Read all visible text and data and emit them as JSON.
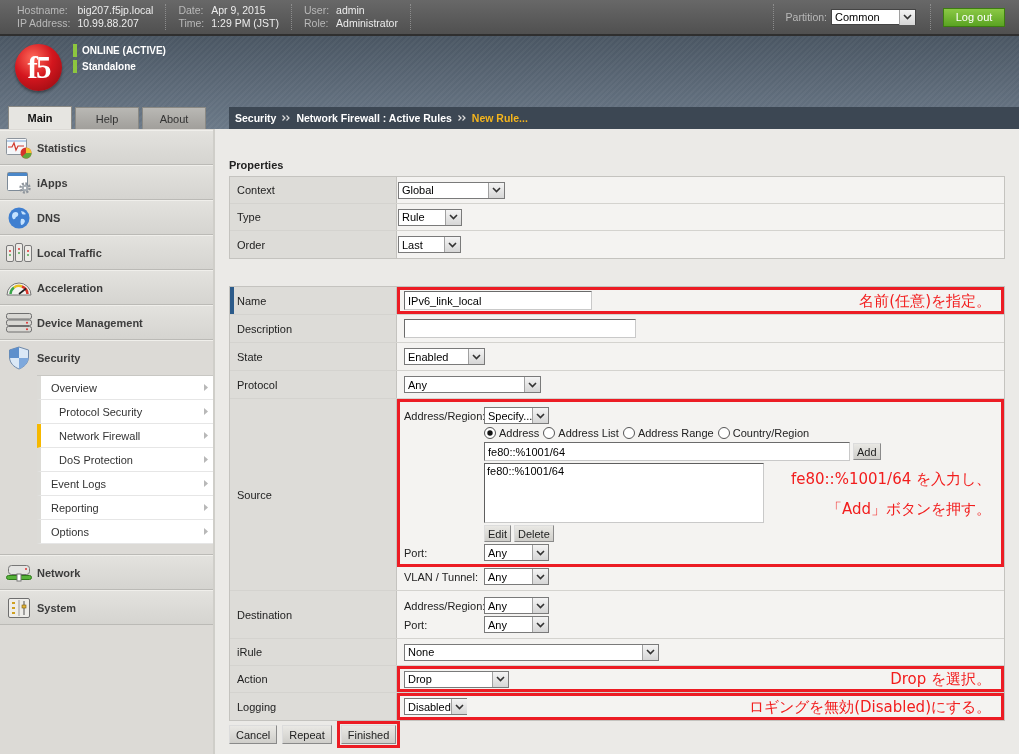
{
  "header": {
    "info_groups": [
      [
        {
          "label": "Hostname:",
          "value": "big207.f5jp.local"
        },
        {
          "label": "IP Address:",
          "value": "10.99.88.207"
        }
      ],
      [
        {
          "label": "Date:",
          "value": "Apr 9, 2015"
        },
        {
          "label": "Time:",
          "value": "1:29 PM (JST)"
        }
      ],
      [
        {
          "label": "User:",
          "value": "admin"
        },
        {
          "label": "Role:",
          "value": "Administrator"
        }
      ]
    ],
    "partition": {
      "label": "Partition:",
      "value": "Common"
    },
    "logout_button": "Log out"
  },
  "banner": {
    "logo_text": "f5",
    "status": [
      "ONLINE (ACTIVE)",
      "Standalone"
    ]
  },
  "tabs": [
    {
      "label": "Main",
      "selected": true
    },
    {
      "label": "Help",
      "selected": false
    },
    {
      "label": "About",
      "selected": false
    }
  ],
  "breadcrumb": [
    {
      "label": "Security",
      "current": false
    },
    {
      "label": "Network Firewall : Active Rules",
      "current": false
    },
    {
      "label": "New Rule...",
      "current": true
    }
  ],
  "sidebar": {
    "items": [
      {
        "label": "Statistics",
        "expanded": false
      },
      {
        "label": "iApps",
        "expanded": false
      },
      {
        "label": "DNS",
        "expanded": false
      },
      {
        "label": "Local Traffic",
        "expanded": false
      },
      {
        "label": "Acceleration",
        "expanded": false
      },
      {
        "label": "Device Management",
        "expanded": false
      },
      {
        "label": "Security",
        "expanded": true,
        "children": [
          {
            "label": "Overview",
            "selected": false,
            "children": [
              {
                "label": "Protocol Security",
                "selected": false
              },
              {
                "label": "Network Firewall",
                "selected": true
              },
              {
                "label": "DoS Protection",
                "selected": false
              }
            ]
          },
          {
            "label": "Event Logs",
            "selected": false
          },
          {
            "label": "Reporting",
            "selected": false
          },
          {
            "label": "Options",
            "selected": false
          }
        ]
      },
      {
        "label": "Network",
        "expanded": false
      },
      {
        "label": "System",
        "expanded": false
      }
    ]
  },
  "form": {
    "section_title": "Properties",
    "properties": [
      {
        "label": "Context",
        "value": "Global"
      },
      {
        "label": "Type",
        "value": "Rule"
      },
      {
        "label": "Order",
        "value": "Last"
      }
    ],
    "rule_rows": [
      {
        "label": "Name",
        "kind": "text",
        "required": true,
        "value": "IPv6_link_local",
        "annotation": [
          "名前(任意)を指定。"
        ]
      },
      {
        "label": "Description",
        "kind": "text",
        "required": false
      },
      {
        "label": "State",
        "kind": "select",
        "required": false,
        "value": "Enabled"
      },
      {
        "label": "Protocol",
        "kind": "select",
        "required": false,
        "value": "Any"
      },
      {
        "label": "Source",
        "kind": "source",
        "required": false,
        "address_region": {
          "label": "Address/Region:",
          "value": "Specify..."
        },
        "address_types": [
          {
            "label": "Address",
            "selected": true
          },
          {
            "label": "Address List",
            "selected": false
          },
          {
            "label": "Address Range",
            "selected": false
          },
          {
            "label": "Country/Region",
            "selected": false
          }
        ],
        "address_input": "fe80::%1001/64",
        "add_button": "Add",
        "address_list": [
          "fe80::%1001/64"
        ],
        "list_buttons": [
          "Edit",
          "Delete"
        ],
        "port": {
          "label": "Port:",
          "value": "Any"
        },
        "vlan": {
          "label": "VLAN / Tunnel:",
          "value": "Any"
        },
        "annotation": [
          "fe80::%1001/64 を入力し、",
          "「Add」ボタンを押す。"
        ]
      },
      {
        "label": "Destination",
        "kind": "destination",
        "required": false,
        "fields": [
          {
            "label": "Address/Region:",
            "value": "Any"
          },
          {
            "label": "Port:",
            "value": "Any"
          }
        ]
      },
      {
        "label": "iRule",
        "kind": "select",
        "required": false,
        "value": "None"
      },
      {
        "label": "Action",
        "kind": "select",
        "required": false,
        "value": "Drop",
        "annotation": [
          "Drop を選択。"
        ]
      },
      {
        "label": "Logging",
        "kind": "select",
        "required": false,
        "value": "Disabled",
        "annotation": [
          "ロギングを無効(Disabled)にする。"
        ]
      }
    ],
    "buttons": [
      {
        "label": "Cancel",
        "highlighted": false
      },
      {
        "label": "Repeat",
        "highlighted": false
      },
      {
        "label": "Finished",
        "highlighted": true
      }
    ]
  }
}
